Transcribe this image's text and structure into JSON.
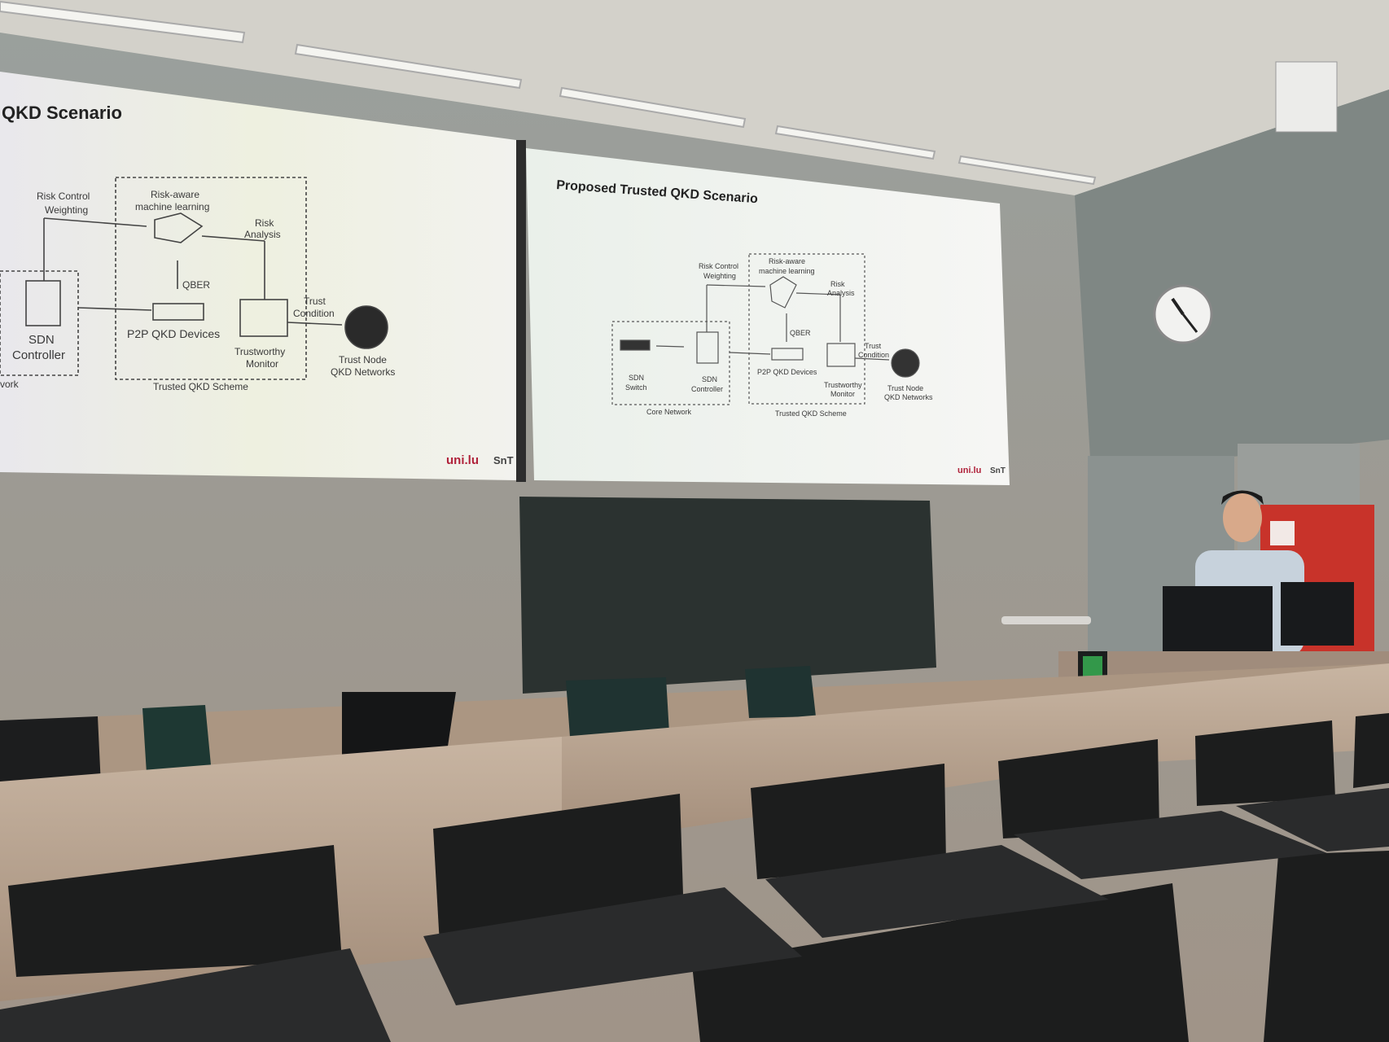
{
  "left_slide": {
    "title": "QKD Scenario",
    "labels": {
      "risk_control": "Risk  Control",
      "weighting": "Weighting",
      "risk_aware_1": "Risk-aware",
      "risk_aware_2": "machine learning",
      "risk_analysis_1": "Risk",
      "risk_analysis_2": "Analysis",
      "qber": "QBER",
      "trust_condition_1": "Trust",
      "trust_condition_2": "Condition",
      "sdn_1": "SDN",
      "sdn_2": "Controller",
      "p2p": "P2P QKD Devices",
      "monitor_1": "Trustworthy",
      "monitor_2": "Monitor",
      "trust_node_1": "Trust Node",
      "trust_node_2": "QKD Networks",
      "scheme": "Trusted QKD Scheme",
      "network_cut": "vork"
    },
    "logo_left": "uni.lu",
    "logo_right": "SnT"
  },
  "right_slide": {
    "title": "Proposed Trusted QKD Scenario",
    "labels": {
      "risk_control_1": "Risk  Control",
      "risk_control_2": "Weighting",
      "risk_aware_1": "Risk-aware",
      "risk_aware_2": "machine learning",
      "risk_analysis_1": "Risk",
      "risk_analysis_2": "Analysis",
      "qber": "QBER",
      "trust_condition_1": "Trust",
      "trust_condition_2": "Condition",
      "sdn_switch_1": "SDN",
      "sdn_switch_2": "Switch",
      "sdn_controller_1": "SDN",
      "sdn_controller_2": "Controller",
      "p2p": "P2P QKD Devices",
      "monitor_1": "Trustworthy",
      "monitor_2": "Monitor",
      "trust_node_1": "Trust Node",
      "trust_node_2": "QKD Networks",
      "core_network": "Core Network",
      "scheme": "Trusted QKD Scheme"
    },
    "logo_left": "uni.lu",
    "logo_right": "SnT"
  },
  "colors": {
    "ceiling": "#cfcdc6",
    "wall": "#8f938f",
    "right_wall": "#7e8683",
    "blackboard": "#2c3230",
    "desk": "#b9a593",
    "chair": "#1d1e1e",
    "slide_bg": "#efefe9",
    "logo_red": "#b0223a",
    "exit_sign": "#3cc25a",
    "door_red": "#c8332a"
  }
}
